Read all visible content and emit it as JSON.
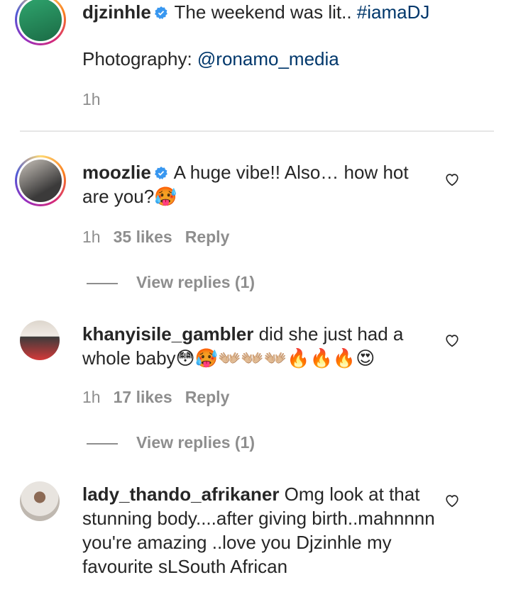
{
  "post": {
    "username": "djzinhle",
    "caption": "The weekend was lit..",
    "hashtag": "#iamaDJ",
    "photo_label": "Photography:",
    "photo_handle": "@ronamo_media",
    "time": "1h"
  },
  "comments": [
    {
      "username": "moozlie",
      "verified": true,
      "text": "A huge vibe!! Also… how hot are you?",
      "emojis": "🥵",
      "time": "1h",
      "likes": "35 likes",
      "reply": "Reply",
      "view_replies": "View replies (1)"
    },
    {
      "username": "khanyisile_gambler",
      "verified": false,
      "text": "did she just had a whole baby",
      "emojis": "😳🥵👐🏼👐🏼👐🏼🔥🔥🔥😍",
      "time": "1h",
      "likes": "17 likes",
      "reply": "Reply",
      "view_replies": "View replies (1)"
    },
    {
      "username": "lady_thando_afrikaner",
      "verified": false,
      "text": "Omg look at that stunning body....after giving birth..mahnnnn you're amazing ..love you Djzinhle my favourite sLSouth African"
    }
  ],
  "icons": {
    "heart": "heart-outline-icon",
    "verified": "verified-badge-icon"
  },
  "colors": {
    "link": "#00376b",
    "verified": "#3897f0",
    "muted": "#8e8e8e"
  }
}
